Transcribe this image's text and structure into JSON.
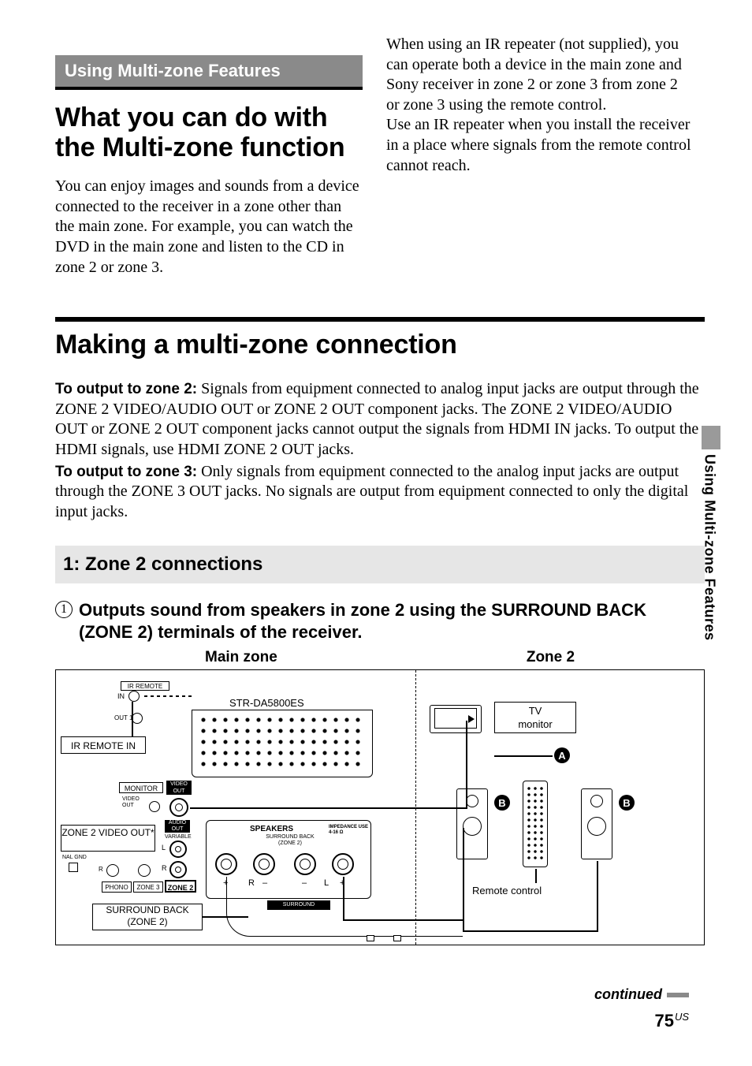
{
  "sidebar": {
    "tab_label": "Using Multi-zone Features"
  },
  "section_label": "Using Multi-zone Features",
  "heading_a": "What you can do with the Multi-zone function",
  "para_a": "You can enjoy images and sounds from a device connected to the receiver in a zone other than the main zone. For example, you can watch the DVD in the main zone and listen to the CD in zone 2 or zone 3.",
  "para_b": "When using an IR repeater (not supplied), you can operate both a device in the main zone and Sony receiver in zone 2 or zone 3 from zone 2 or zone 3 using the remote control.\nUse an IR repeater when you install the receiver in a place where signals from the remote control cannot reach.",
  "heading_b": "Making a multi-zone connection",
  "zone2": {
    "lead_bold": "To output to zone 2:",
    "lead_text": " Signals from equipment connected to analog input jacks are output through the ZONE 2 VIDEO/AUDIO OUT or ZONE 2 OUT component jacks. The ZONE 2 VIDEO/AUDIO OUT or ZONE 2 OUT component jacks cannot output the signals from HDMI IN jacks. To output the HDMI signals, use HDMI ZONE 2 OUT jacks."
  },
  "zone3": {
    "lead_bold": "To output to zone 3:",
    "lead_text": " Only signals from equipment connected to the analog input jacks are output through the ZONE 3 OUT jacks. No signals are output from equipment connected to only the digital input jacks."
  },
  "subhead": "1: Zone 2 connections",
  "step1": {
    "num": "1",
    "text": "Outputs sound from speakers in zone 2 using the SURROUND BACK (ZONE 2) terminals of the receiver."
  },
  "zones": {
    "main": "Main zone",
    "z2": "Zone 2"
  },
  "diagram": {
    "model": "STR-DA5800ES",
    "ir_remote_in": "IR REMOTE IN",
    "ir_remote": "IR REMOTE",
    "in_small": "IN",
    "out1_small": "OUT 1",
    "monitor": "MONITOR",
    "video_out_small": "VIDEO OUT",
    "video_out_tiny": "VIDEO OUT",
    "zone2_video_out": "ZONE 2 VIDEO OUT*",
    "audio_out": "AUDIO OUT",
    "variable": "VARIABLE",
    "phono": "PHONO",
    "zone3": "ZONE 3",
    "zone2_box": "ZONE 2",
    "nal_gnd": "NAL GND",
    "speakers": "SPEAKERS",
    "surround_back_zone2_small": "SURROUND BACK (ZONE 2)",
    "impedance": "IMPEDANCE USE 4-16 Ω",
    "surround_label": "SURROUND",
    "surround_back_callout_l1": "SURROUND BACK",
    "surround_back_callout_l2": "(ZONE 2)",
    "tv_monitor_l1": "TV",
    "tv_monitor_l2": "monitor",
    "remote_control": "Remote control",
    "badge_a": "A",
    "badge_b": "B",
    "plus": "+",
    "minus": "–",
    "r": "R",
    "l": "L"
  },
  "continued": "continued",
  "page": {
    "num": "75",
    "region": "US"
  }
}
